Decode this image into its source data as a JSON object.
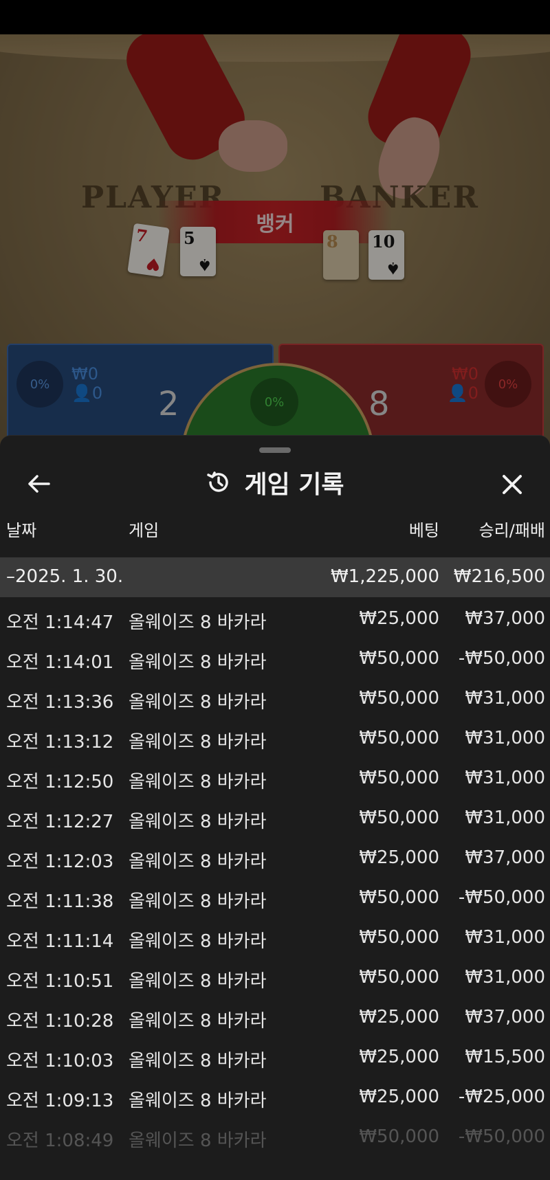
{
  "game_view": {
    "player_label": "PLAYER",
    "banker_label": "BANKER",
    "result_banner": "뱅커",
    "player_cards": [
      {
        "rank": "7",
        "suit": "♥",
        "color": "red"
      },
      {
        "rank": "5",
        "suit": "♠",
        "color": "black"
      }
    ],
    "banker_cards": [
      {
        "rank": "8",
        "suit": "",
        "color": "back"
      },
      {
        "rank": "10",
        "suit": "♠",
        "color": "black"
      }
    ],
    "player_box": {
      "percent": "0%",
      "amount": "₩0",
      "bettors": "0",
      "score": "2"
    },
    "banker_box": {
      "percent": "0%",
      "amount": "₩0",
      "bettors": "0",
      "score": "8"
    },
    "tie_box": {
      "percent": "0%"
    }
  },
  "history": {
    "title": "게임 기록",
    "columns": {
      "date": "날짜",
      "game": "게임",
      "bet": "베팅",
      "winloss": "승리/패배"
    },
    "summary": {
      "date": "–2025. 1. 30.",
      "bet": "₩1,225,000",
      "winloss": "₩216,500"
    },
    "rows": [
      {
        "time": "오전 1:14:47",
        "game": "올웨이즈 8 바카라",
        "bet": "₩25,000",
        "winloss": "₩37,000"
      },
      {
        "time": "오전 1:14:01",
        "game": "올웨이즈 8 바카라",
        "bet": "₩50,000",
        "winloss": "-₩50,000"
      },
      {
        "time": "오전 1:13:36",
        "game": "올웨이즈 8 바카라",
        "bet": "₩50,000",
        "winloss": "₩31,000"
      },
      {
        "time": "오전 1:13:12",
        "game": "올웨이즈 8 바카라",
        "bet": "₩50,000",
        "winloss": "₩31,000"
      },
      {
        "time": "오전 1:12:50",
        "game": "올웨이즈 8 바카라",
        "bet": "₩50,000",
        "winloss": "₩31,000"
      },
      {
        "time": "오전 1:12:27",
        "game": "올웨이즈 8 바카라",
        "bet": "₩50,000",
        "winloss": "₩31,000"
      },
      {
        "time": "오전 1:12:03",
        "game": "올웨이즈 8 바카라",
        "bet": "₩25,000",
        "winloss": "₩37,000"
      },
      {
        "time": "오전 1:11:38",
        "game": "올웨이즈 8 바카라",
        "bet": "₩50,000",
        "winloss": "-₩50,000"
      },
      {
        "time": "오전 1:11:14",
        "game": "올웨이즈 8 바카라",
        "bet": "₩50,000",
        "winloss": "₩31,000"
      },
      {
        "time": "오전 1:10:51",
        "game": "올웨이즈 8 바카라",
        "bet": "₩50,000",
        "winloss": "₩31,000"
      },
      {
        "time": "오전 1:10:28",
        "game": "올웨이즈 8 바카라",
        "bet": "₩25,000",
        "winloss": "₩37,000"
      },
      {
        "time": "오전 1:10:03",
        "game": "올웨이즈 8 바카라",
        "bet": "₩25,000",
        "winloss": "₩15,500"
      },
      {
        "time": "오전 1:09:13",
        "game": "올웨이즈 8 바카라",
        "bet": "₩25,000",
        "winloss": "-₩25,000"
      },
      {
        "time": "오전 1:08:49",
        "game": "올웨이즈 8 바카라",
        "bet": "₩50,000",
        "winloss": "-₩50,000"
      }
    ],
    "icons": {
      "back": "arrow-left-icon",
      "history": "history-clock-icon",
      "close": "close-icon"
    }
  }
}
